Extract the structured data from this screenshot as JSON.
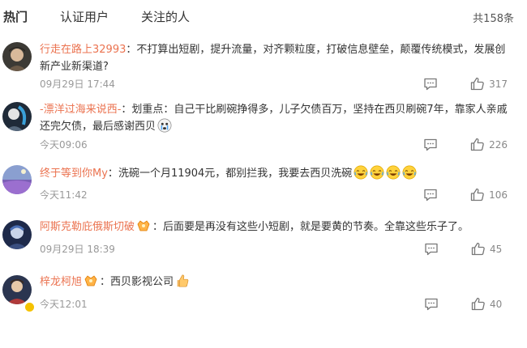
{
  "tabs": {
    "hot": "热门",
    "verified": "认证用户",
    "following": "关注的人"
  },
  "total_count": "共158条",
  "comments": [
    {
      "user": "行走在路上32993",
      "separator": "：",
      "text": "不打算出短剧，提升流量，对齐颗粒度，打破信息壁垒，颠覆传统模式，发展创新产业新渠道?",
      "time": "09月29日 17:44",
      "likes": "317"
    },
    {
      "user": "-漂洋过海来说西-",
      "separator": "：",
      "text": "划重点：自己干比刷碗挣得多，儿子欠债百万，坚持在西贝刷碗7年，靠家人亲戚还完欠债，最后感谢西贝",
      "time": "今天09:06",
      "likes": "226"
    },
    {
      "user": "终于等到你My",
      "separator": "：",
      "text": "洗碗一个月11904元，都别拦我，我要去西贝洗碗",
      "time": "今天11:42",
      "likes": "106"
    },
    {
      "user": "阿斯克勒庇俄斯切破",
      "separator": "：",
      "text": "后面要是再没有这些小短剧，就是要黄的节奏。全靠这些乐子了。",
      "time": "09月29日 18:39",
      "likes": "45"
    },
    {
      "user": "梓龙柯旭",
      "separator": "：",
      "text": "西贝影视公司",
      "time": "今天12:01",
      "likes": "40"
    }
  ],
  "colors": {
    "username": "#eb7350",
    "time": "#999999",
    "text": "#333333"
  }
}
